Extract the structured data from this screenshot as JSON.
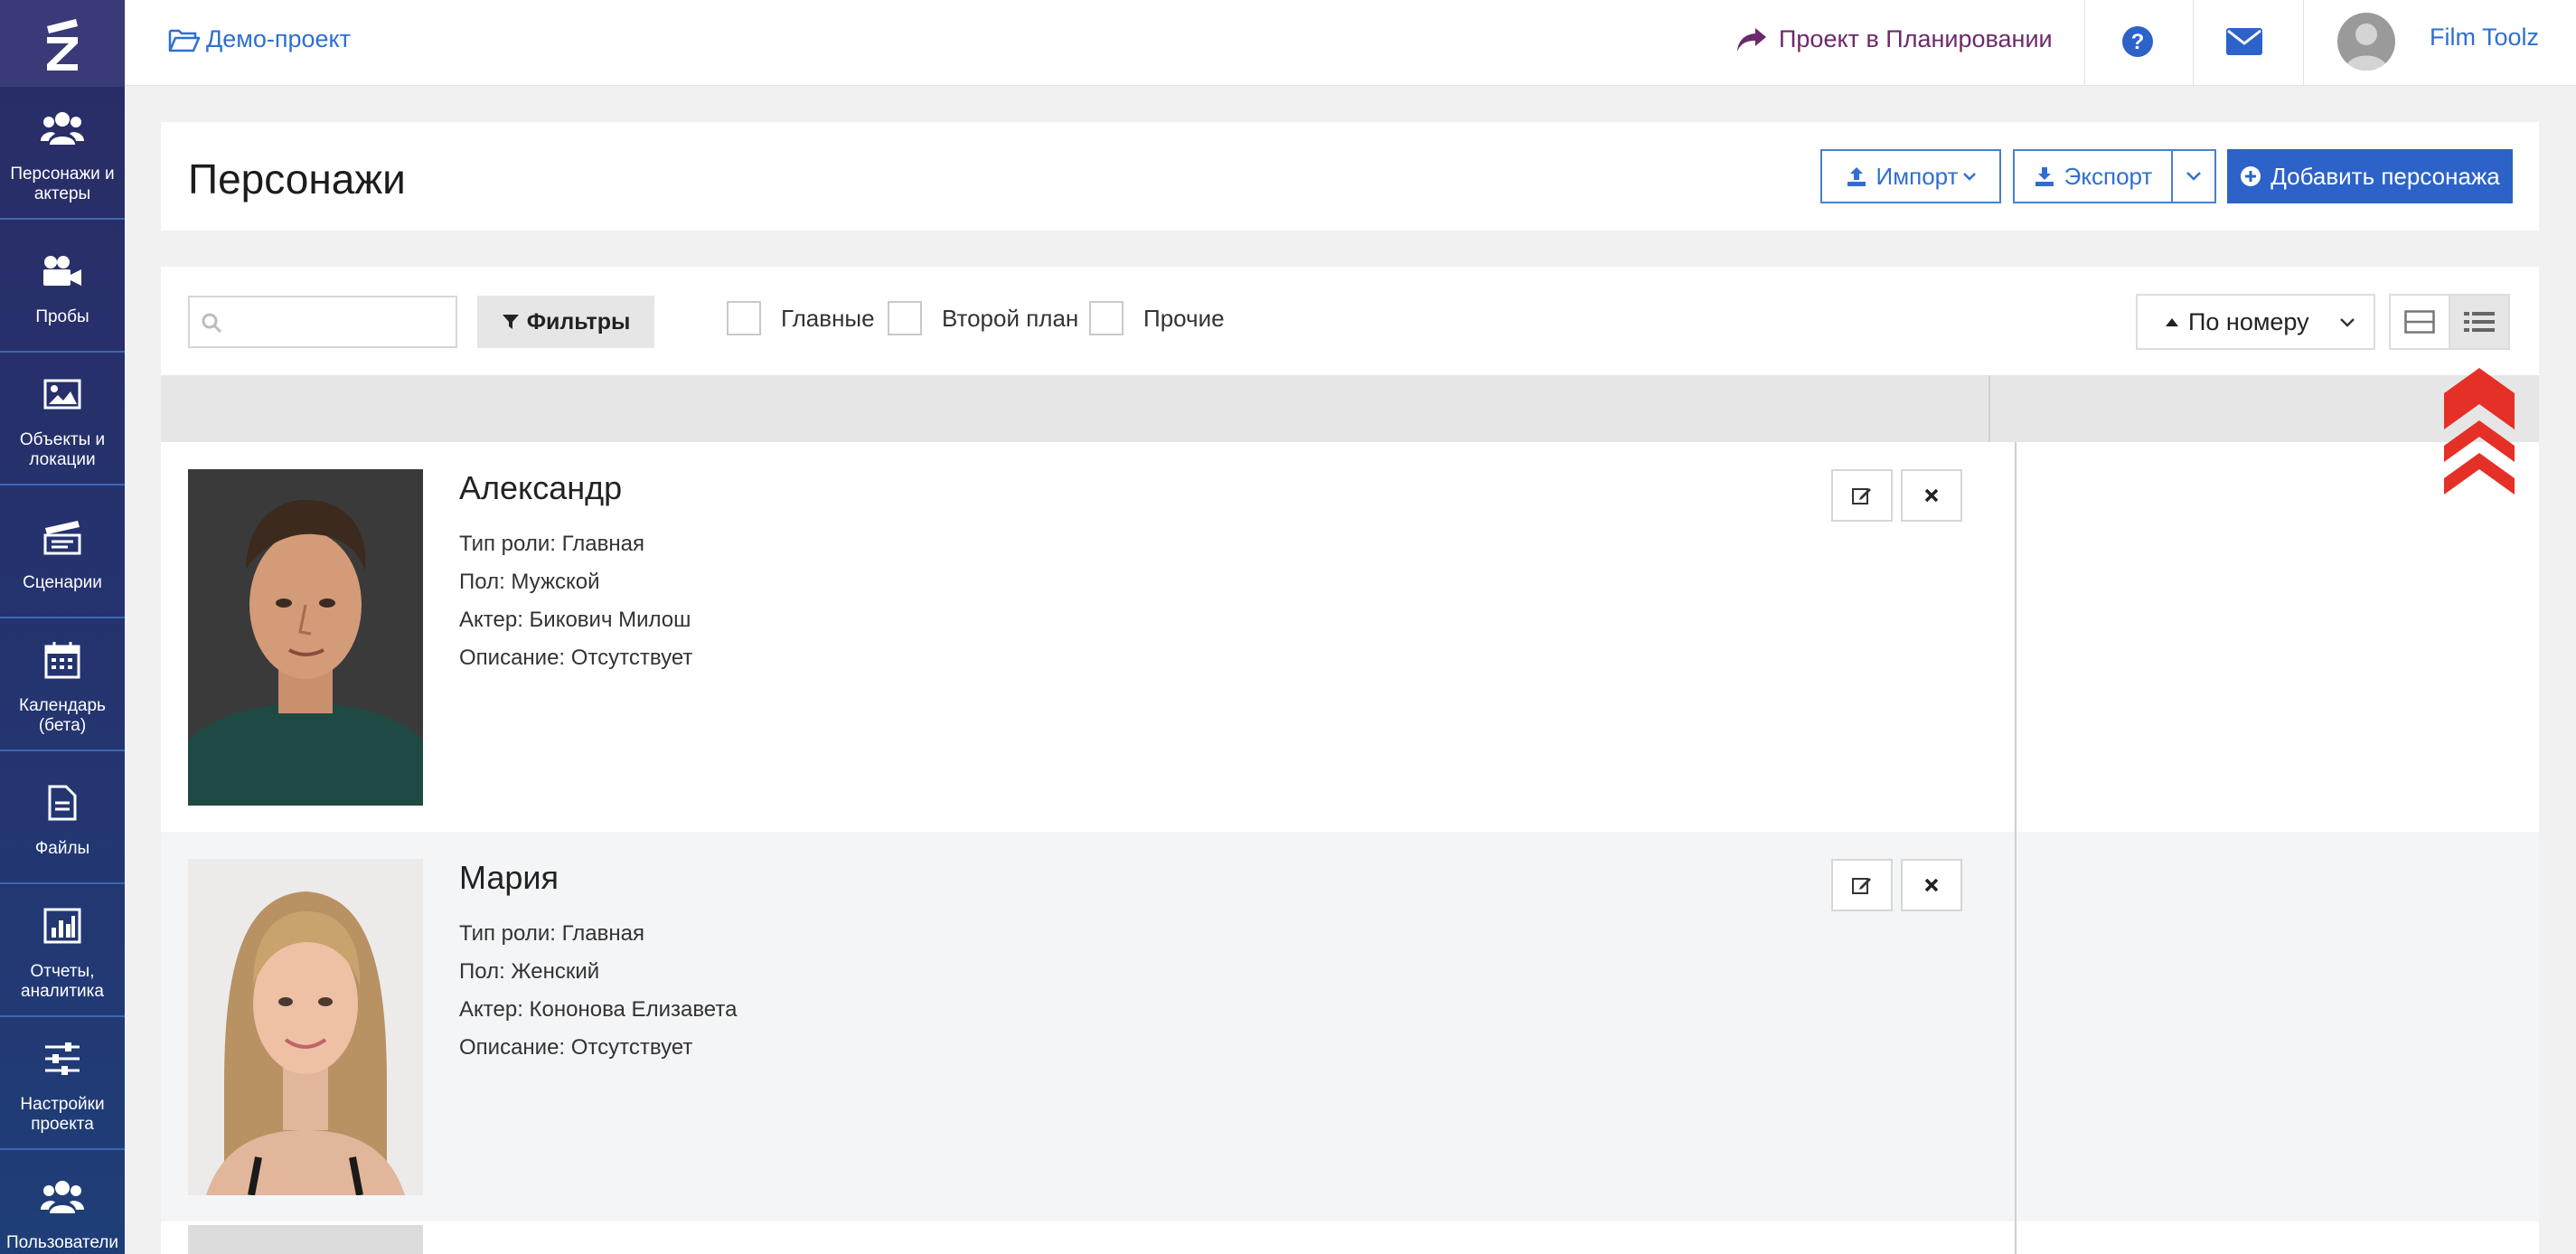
{
  "sidebar": {
    "logo": "Z",
    "items": [
      {
        "label": "Персонажи и актеры",
        "icon": "users-icon"
      },
      {
        "label": "Пробы",
        "icon": "video-camera-icon"
      },
      {
        "label": "Объекты и локации",
        "icon": "image-icon"
      },
      {
        "label": "Сценарии",
        "icon": "clapperboard-icon"
      },
      {
        "label": "Календарь (бета)",
        "icon": "calendar-icon"
      },
      {
        "label": "Файлы",
        "icon": "file-icon"
      },
      {
        "label": "Отчеты, аналитика",
        "icon": "bar-chart-icon"
      },
      {
        "label": "Настройки проекта",
        "icon": "sliders-icon"
      },
      {
        "label": "Пользователи и",
        "icon": "users-icon"
      }
    ]
  },
  "topbar": {
    "project": "Демо-проект",
    "status": "Проект в Планировании",
    "user": "Film Toolz"
  },
  "header": {
    "title": "Персонажи",
    "import_label": "Импорт",
    "export_label": "Экспорт",
    "add_label": "Добавить персонажа"
  },
  "filters": {
    "search_placeholder": "",
    "filters_label": "Фильтры",
    "checkboxes": [
      "Главные",
      "Второй план",
      "Прочие"
    ],
    "sort_label": "По номеру"
  },
  "characters": [
    {
      "name": "Александр",
      "role": "Тип роли: Главная",
      "gender": "Пол: Мужской",
      "actor": "Актер: Бикович Милош",
      "description": "Описание: Отсутствует"
    },
    {
      "name": "Мария",
      "role": "Тип роли: Главная",
      "gender": "Пол: Женский",
      "actor": "Актер: Кононова Елизавета",
      "description": "Описание: Отсутствует"
    }
  ],
  "colors": {
    "sidebar": "#26336e",
    "accent": "#2d63c8",
    "link": "#2f6fd1",
    "status": "#6b2a6b",
    "scroll_top": "#e53027"
  }
}
